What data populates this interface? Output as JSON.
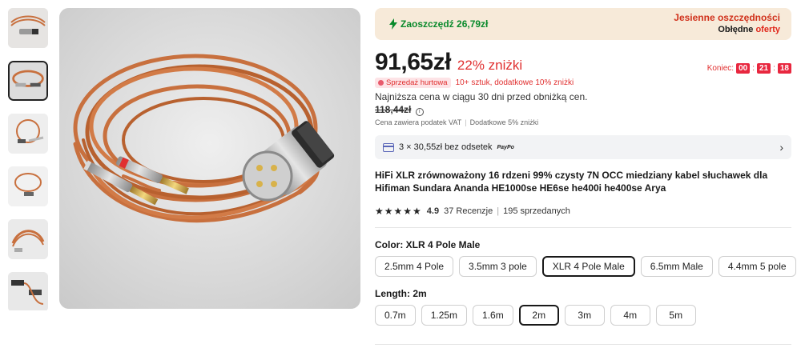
{
  "gallery": {
    "thumbnails": [
      {
        "name": "thumb-1",
        "active": false
      },
      {
        "name": "thumb-2",
        "active": true
      },
      {
        "name": "thumb-3",
        "active": false
      },
      {
        "name": "thumb-4",
        "active": false
      },
      {
        "name": "thumb-5",
        "active": false
      },
      {
        "name": "thumb-6",
        "active": false
      }
    ]
  },
  "promo": {
    "saving": "Zaoszczędź 26,79zł",
    "title": "Jesienne oszczędności",
    "sub_prefix": "Obłędne ",
    "sub_accent": "oferty"
  },
  "price": {
    "current": "91,65zł",
    "discount": "22% zniżki",
    "timer_label": "Koniec:",
    "timer": [
      "00",
      "21",
      "18"
    ],
    "wholesale_tag": "Sprzedaż hurtowa",
    "wholesale_text": "10+ sztuk, dodatkowe 10% zniżki",
    "lowest_text": "Najniższa cena w ciągu 30 dni przed obniżką cen.",
    "lowest_price": "118,44zł",
    "vat": "Cena zawiera podatek VAT",
    "extra": "Dodatkowe 5% zniżki"
  },
  "installments": {
    "text": "3 × 30,55zł bez odsetek",
    "provider": "PayPo"
  },
  "product": {
    "title": "HiFi XLR zrównoważony 16 rdzeni 99% czysty 7N OCC miedziany kabel słuchawek dla Hifiman Sundara Ananda HE1000se HE6se he400i he400se Arya",
    "rating": "4.9",
    "reviews": "37 Recenzje",
    "sold": "195 sprzedanych"
  },
  "color": {
    "label": "Color: XLR 4 Pole Male",
    "options": [
      "2.5mm 4 Pole",
      "3.5mm 3 pole",
      "XLR 4 Pole Male",
      "6.5mm Male",
      "4.4mm 5 pole"
    ],
    "selected": "XLR 4 Pole Male"
  },
  "length": {
    "label": "Length: 2m",
    "options": [
      "0.7m",
      "1.25m",
      "1.6m",
      "2m",
      "3m",
      "4m",
      "5m"
    ],
    "selected": "2m"
  },
  "colors": {
    "accent_red": "#e02f2f",
    "saving_green": "#0a8a2c",
    "promo_bg": "#f7ead9",
    "cable_copper": "#c8703e"
  }
}
